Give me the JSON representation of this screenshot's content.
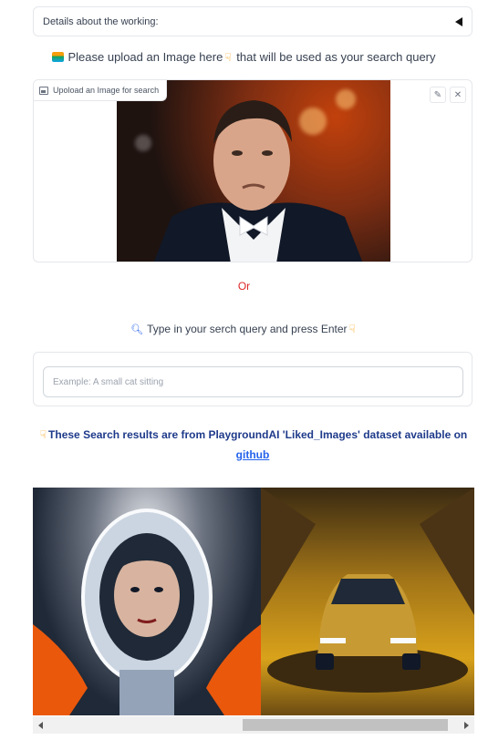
{
  "accordion": {
    "label": "Details about the working:"
  },
  "upload_prompt": {
    "text_a": "Please upload an Image here",
    "text_b": "that will be used as your search query"
  },
  "image_upload": {
    "label": "Upoload an Image for search",
    "photo_icon": "portrait-photo",
    "edit_icon": "pencil-icon",
    "clear_icon": "close-icon"
  },
  "divider": {
    "or": "Or"
  },
  "text_prompt": {
    "text": "Type in your serch query and press Enter"
  },
  "search": {
    "value": "",
    "placeholder": "Example: A small cat sitting"
  },
  "info": {
    "text": "These Search results are from PlaygroundAI 'Liked_Images' dataset available on",
    "link": "github"
  },
  "gallery": {
    "items": [
      "astronaut-portrait-image",
      "car-image"
    ]
  },
  "colors": {
    "accent_red": "#dc2626",
    "info_blue": "#1e3a8a",
    "link_blue": "#2563eb"
  }
}
